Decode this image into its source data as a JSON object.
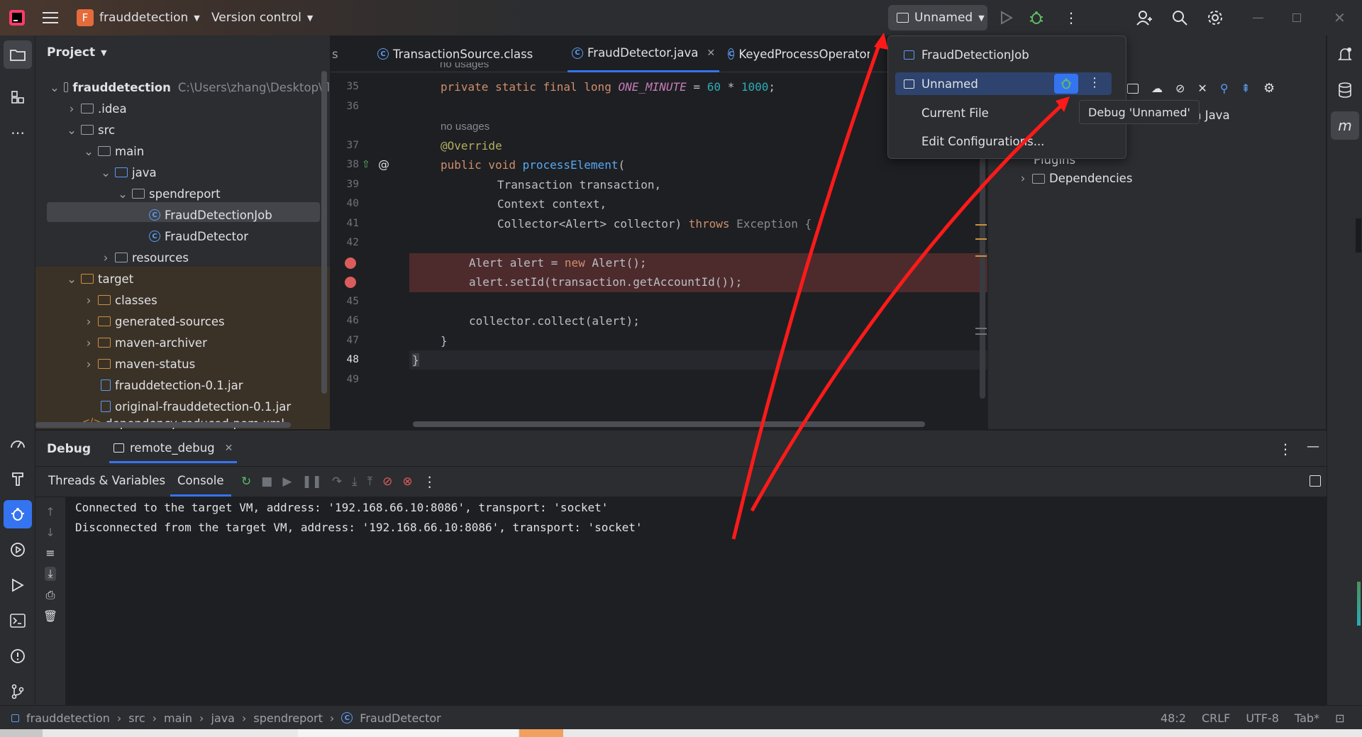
{
  "titlebar": {
    "project_initial": "F",
    "project_name": "frauddetection",
    "vcs": "Version control",
    "run_config": "Unnamed"
  },
  "project_panel": {
    "title": "Project",
    "root_name": "frauddetection",
    "root_path": "C:\\Users\\zhang\\Desktop\\fl",
    "items": {
      "idea": ".idea",
      "src": "src",
      "main": "main",
      "java": "java",
      "spendreport": "spendreport",
      "job": "FraudDetectionJob",
      "detector": "FraudDetector",
      "resources": "resources",
      "target": "target",
      "classes": "classes",
      "generated": "generated-sources",
      "archiver": "maven-archiver",
      "status": "maven-status",
      "jar1": "frauddetection-0.1.jar",
      "jar2": "original-frauddetection-0.1.jar",
      "pom": "dependency-reduced-pom.xml"
    }
  },
  "tabs": {
    "t0": "s",
    "t1": "TransactionSource.class",
    "t2": "FraudDetector.java",
    "t3": "KeyedProcessOperator.cla"
  },
  "editor": {
    "lines": {
      "l34": "no usages",
      "l35": "35",
      "l36": "36",
      "l37": "37",
      "l38": "38",
      "l39": "39",
      "l40": "40",
      "l41": "41",
      "l42": "42",
      "l45": "45",
      "l46": "46",
      "l47": "47",
      "l48": "48",
      "l49": "49"
    },
    "code": {
      "c35a": "private static final long ",
      "c35b": "ONE_MINUTE",
      "c35c": " = ",
      "c35d": "60",
      "c35e": " * ",
      "c35f": "1000",
      "c35g": ";",
      "hint": "no usages",
      "c37": "@Override",
      "c38a": "public void ",
      "c38b": "processElement",
      "c38c": "(",
      "c39": "Transaction transaction,",
      "c40": "Context context,",
      "c41a": "Collector<Alert> collector) ",
      "c41b": "throws",
      "c41c": " Exception {",
      "c43a": "Alert alert = ",
      "c43b": "new",
      "c43c": " Alert();",
      "c44": "alert.setId(transaction.getAccountId());",
      "c46": "collector.collect(alert);",
      "c47": "}",
      "c48": "}"
    }
  },
  "right_pane": {
    "java_label": "n Java",
    "plugins": "Plugins",
    "dependencies": "Dependencies"
  },
  "popup": {
    "item1": "FraudDetectionJob",
    "item2": "Unnamed",
    "item3": "Current File",
    "item4": "Edit Configurations...",
    "tooltip": "Debug 'Unnamed'"
  },
  "debug": {
    "title": "Debug",
    "session": "remote_debug",
    "tab_threads": "Threads & Variables",
    "tab_console": "Console",
    "console_lines": [
      "Connected to the target VM, address: '192.168.66.10:8086', transport: 'socket'",
      "Disconnected from the target VM, address: '192.168.66.10:8086', transport: 'socket'"
    ]
  },
  "statusbar": {
    "crumbs": [
      "frauddetection",
      "src",
      "main",
      "java",
      "spendreport",
      "FraudDetector"
    ],
    "position": "48:2",
    "line_sep": "CRLF",
    "encoding": "UTF-8",
    "indent": "Tab*"
  },
  "colors": {
    "accent": "#3574f0",
    "breakpoint": "#db5c5c",
    "annotation_arrow": "#ff1a1a"
  }
}
